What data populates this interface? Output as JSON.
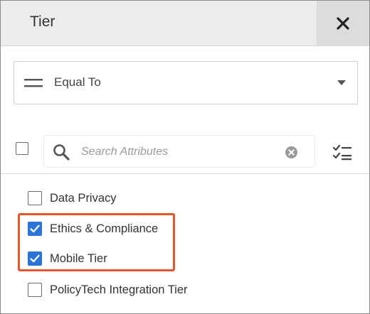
{
  "header": {
    "title": "Tier",
    "close_icon": "close-icon"
  },
  "operator": {
    "label": "Equal To",
    "icon": "equals-icon"
  },
  "search": {
    "placeholder": "Search Attributes",
    "value": ""
  },
  "attributes": [
    {
      "label": "Data Privacy",
      "checked": false
    },
    {
      "label": "Ethics & Compliance",
      "checked": true
    },
    {
      "label": "Mobile Tier",
      "checked": true
    },
    {
      "label": "PolicyTech Integration Tier",
      "checked": false
    }
  ],
  "colors": {
    "accent": "#2a73d9",
    "highlight": "#e8542b"
  }
}
